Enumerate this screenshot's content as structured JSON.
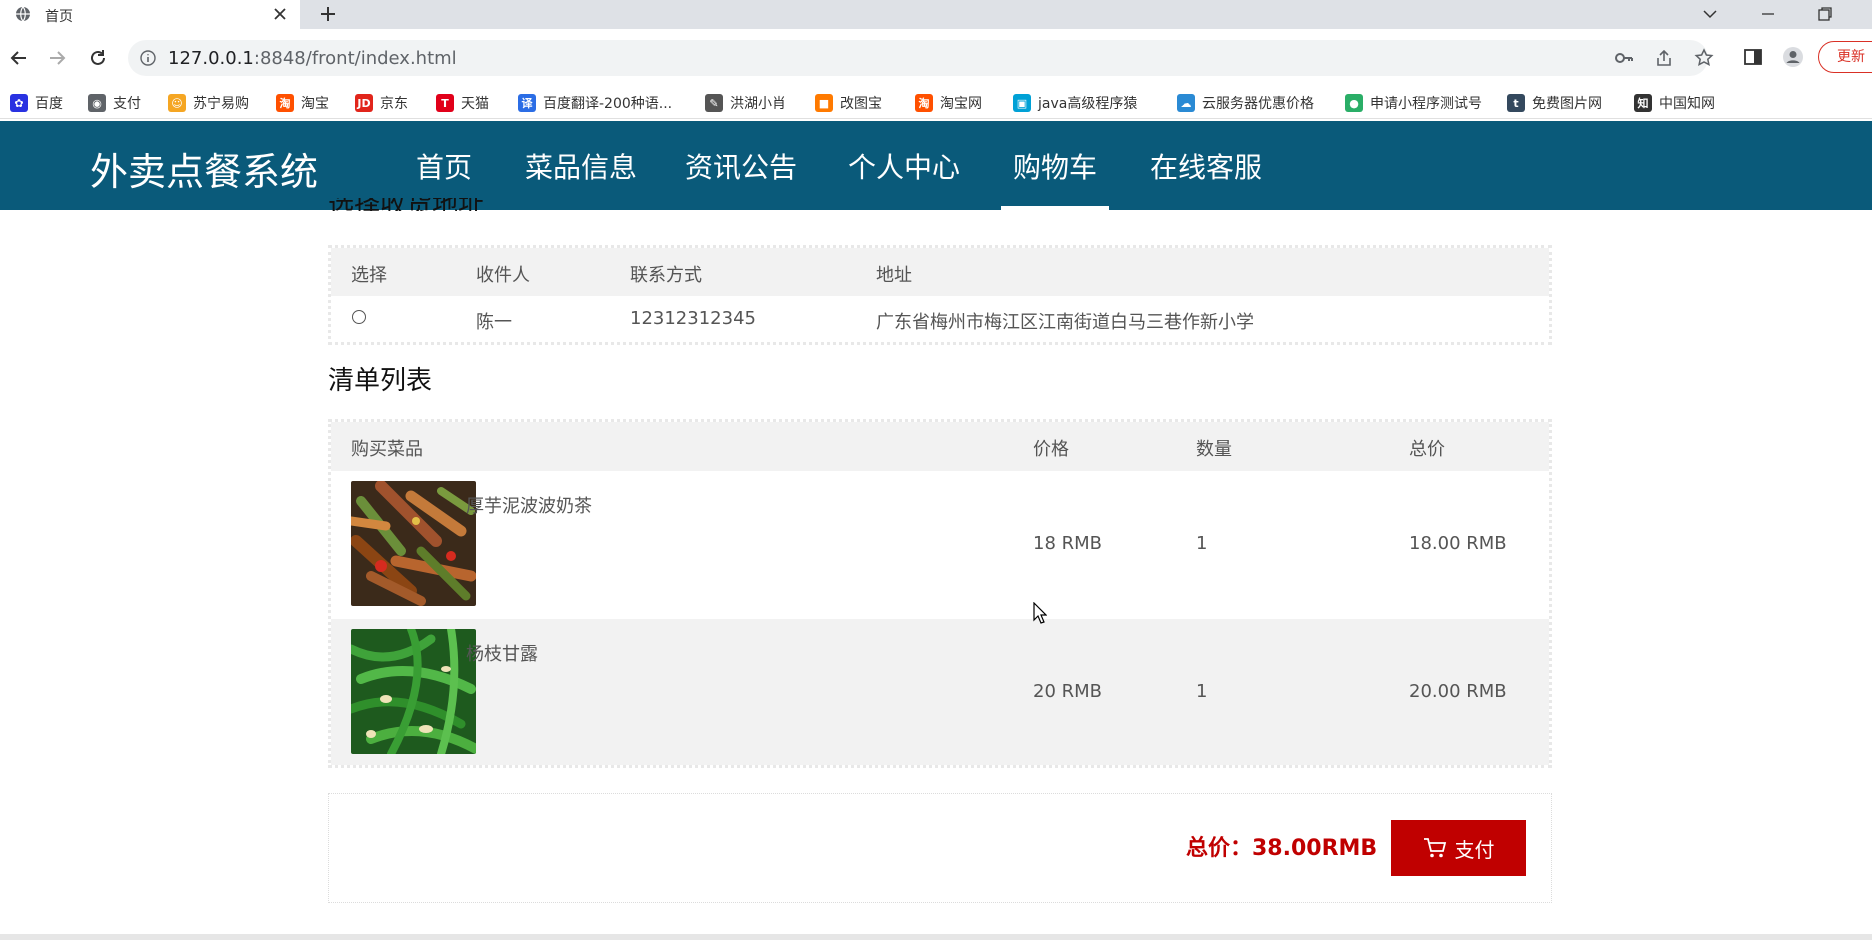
{
  "browser": {
    "tab_title": "首页",
    "url_host": "127.0.0.1",
    "url_rest": ":8848/front/index.html",
    "update_label": "更新",
    "bookmarks": [
      {
        "label": "百度",
        "color": "#2932e1"
      },
      {
        "label": "支付",
        "color": "#5f6368"
      },
      {
        "label": "苏宁易购",
        "color": "#f5a623"
      },
      {
        "label": "淘宝",
        "color": "#ff5000"
      },
      {
        "label": "京东",
        "color": "#e1251b"
      },
      {
        "label": "天猫",
        "color": "#e1001a"
      },
      {
        "label": "百度翻译-200种语...",
        "color": "#2b6de5"
      },
      {
        "label": "洪湖小肖",
        "color": "#555555"
      },
      {
        "label": "改图宝",
        "color": "#ff7a00"
      },
      {
        "label": "淘宝网",
        "color": "#ff5000"
      },
      {
        "label": "java高级程序猿",
        "color": "#00a1d6"
      },
      {
        "label": "云服务器优惠价格",
        "color": "#2a8ad4"
      },
      {
        "label": "申请小程序测试号",
        "color": "#2aae67"
      },
      {
        "label": "免费图片网",
        "color": "#34495e"
      },
      {
        "label": "中国知网",
        "color": "#333333"
      }
    ]
  },
  "site": {
    "brand": "外卖点餐系统",
    "nav": [
      "首页",
      "菜品信息",
      "资讯公告",
      "个人中心",
      "购物车",
      "在线客服"
    ],
    "active_nav": "购物车",
    "header_color": "#0a5a7a"
  },
  "address": {
    "section_title": "选择收货地址",
    "headers": [
      "选择",
      "收件人",
      "联系方式",
      "地址"
    ],
    "rows": [
      {
        "recipient": "陈一",
        "phone": "12312312345",
        "address": "广东省梅州市梅江区江南街道白马三巷作新小学"
      }
    ]
  },
  "cart": {
    "section_title": "清单列表",
    "headers": [
      "购买菜品",
      "价格",
      "数量",
      "总价"
    ],
    "items": [
      {
        "name": "厚芋泥波波奶茶",
        "price": "18 RMB",
        "qty": "1",
        "total": "18.00 RMB"
      },
      {
        "name": "杨枝甘露",
        "price": "20 RMB",
        "qty": "1",
        "total": "20.00 RMB"
      }
    ]
  },
  "summary": {
    "total_text": "总价：38.00RMB",
    "pay_label": "支付",
    "accent_color": "#c00000"
  }
}
